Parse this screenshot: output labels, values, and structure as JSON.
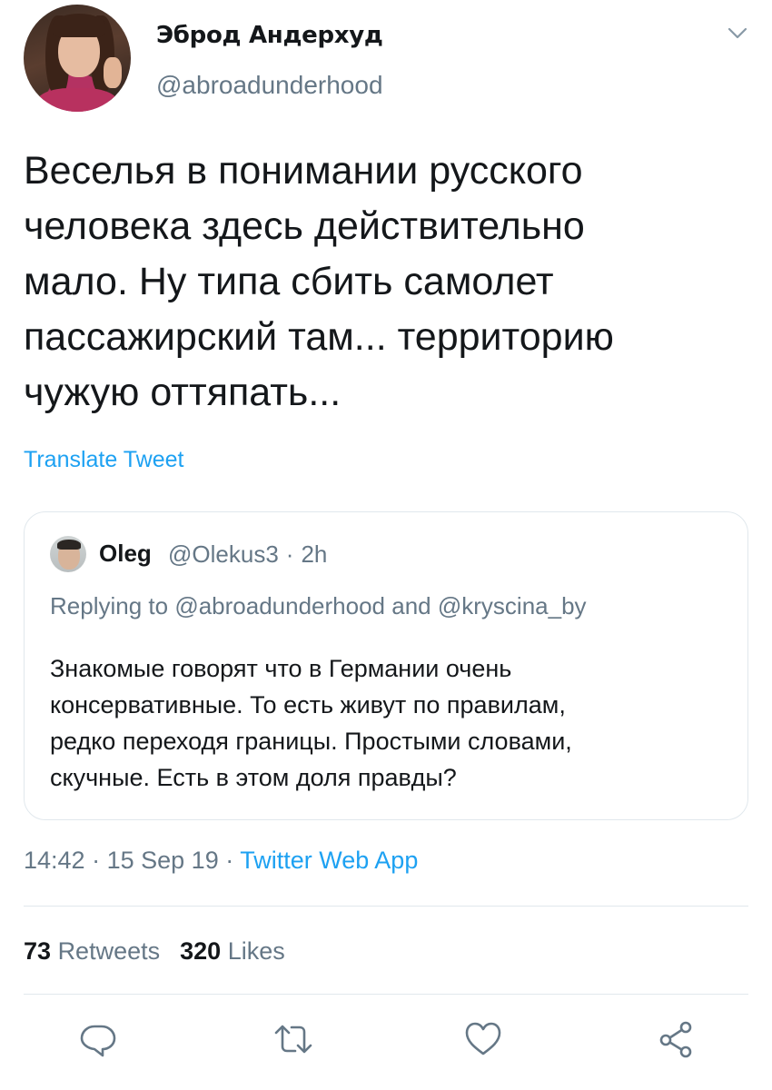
{
  "author": {
    "display_name": "Эброд Андерхуд",
    "handle": "@abroadunderhood"
  },
  "tweet": {
    "text": "Веселья в понимании русского\nчеловека здесь действительно\nмало. Ну типа сбить самолет\nпассажирский там... территорию\nчужую оттяпать...",
    "translate_label": "Translate Tweet"
  },
  "quoted_tweet": {
    "name": "Oleg",
    "handle": "@Olekus3",
    "separator": "·",
    "time": "2h",
    "replying_prefix": "Replying to",
    "reply_to_1": "@abroadunderhood",
    "reply_and": "and",
    "reply_to_2": "@kryscina_by",
    "text": "Знакомые говорят что в Германии очень\nконсервативные. То есть живут по правилам,\nредко переходя границы. Простыми словами,\nскучные. Есть в этом доля правды?"
  },
  "meta": {
    "time": "14:42",
    "separator": "·",
    "date": "15 Sep 19",
    "client": "Twitter Web App"
  },
  "stats": {
    "retweets_count": "73",
    "retweets_label": "Retweets",
    "likes_count": "320",
    "likes_label": "Likes"
  },
  "icons": {
    "menu": "chevron-down-icon",
    "reply": "reply-icon",
    "retweet": "retweet-icon",
    "like": "heart-icon",
    "share": "share-icon"
  },
  "colors": {
    "accent": "#1da1f2",
    "secondary_text": "#657786",
    "primary_text": "#14171a",
    "border": "#e1e8ed"
  }
}
